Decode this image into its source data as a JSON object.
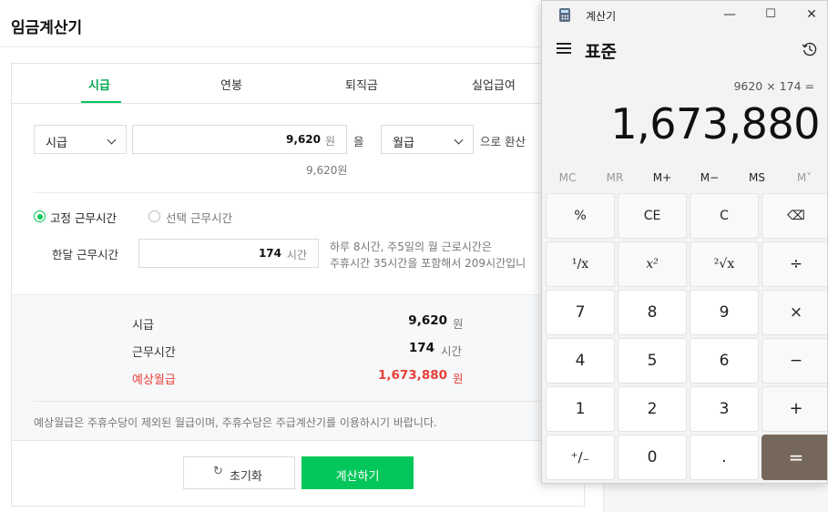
{
  "page": {
    "title": "임금계산기",
    "tabs": [
      "시급",
      "연봉",
      "퇴직금",
      "실업급여"
    ],
    "active_tab_index": 0,
    "converter": {
      "from_select": "시급",
      "amount_value": "9,620",
      "amount_unit": "원",
      "particle_eul": "을",
      "to_select": "월급",
      "suffix": "으로 환산",
      "amount_hint": "9,620원"
    },
    "work_mode": {
      "fixed_label": "고정 근무시간",
      "optional_label": "선택 근무시간",
      "fixed_selected": true
    },
    "monthly_hours": {
      "label": "한달 근무시간",
      "value": "174",
      "unit": "시간",
      "note_line1": "하루 8시간, 주5일의 월 근로시간은",
      "note_line2": "주휴시간 35시간을 포함해서 209시간입니"
    },
    "summary": {
      "rows": [
        {
          "label": "시급",
          "value": "9,620",
          "unit": "원"
        },
        {
          "label": "근무시간",
          "value": "174",
          "unit": "시간"
        },
        {
          "label": "예상월급",
          "value": "1,673,880",
          "unit": "원"
        }
      ],
      "notice": "예상월급은 주휴수당이 제외된 월급이며, 주휴수당은 주급계산기를 이용하시기 바랍니다."
    },
    "buttons": {
      "reset": "초기화",
      "calculate": "계산하기"
    },
    "colors": {
      "brand_green": "#03c75a",
      "highlight_red": "#e8413a"
    }
  },
  "calculator": {
    "window_title": "계산기",
    "controls": {
      "minimize": "—",
      "maximize": "☐",
      "close": "✕"
    },
    "mode": "표준",
    "expression": "9620 × 174 =",
    "display": "1,673,880",
    "memory": [
      "MC",
      "MR",
      "M+",
      "M−",
      "MS",
      "M˅"
    ],
    "memory_enabled": [
      false,
      false,
      true,
      true,
      true,
      false
    ],
    "keys": [
      [
        "%",
        "CE",
        "C",
        "⌫"
      ],
      [
        "¹∕x",
        "x²",
        "²√x",
        "÷"
      ],
      [
        "7",
        "8",
        "9",
        "×"
      ],
      [
        "4",
        "5",
        "6",
        "−"
      ],
      [
        "1",
        "2",
        "3",
        "+"
      ],
      [
        "⁺∕₋",
        "0",
        ".",
        "="
      ]
    ],
    "equals_color": "#75685a"
  }
}
